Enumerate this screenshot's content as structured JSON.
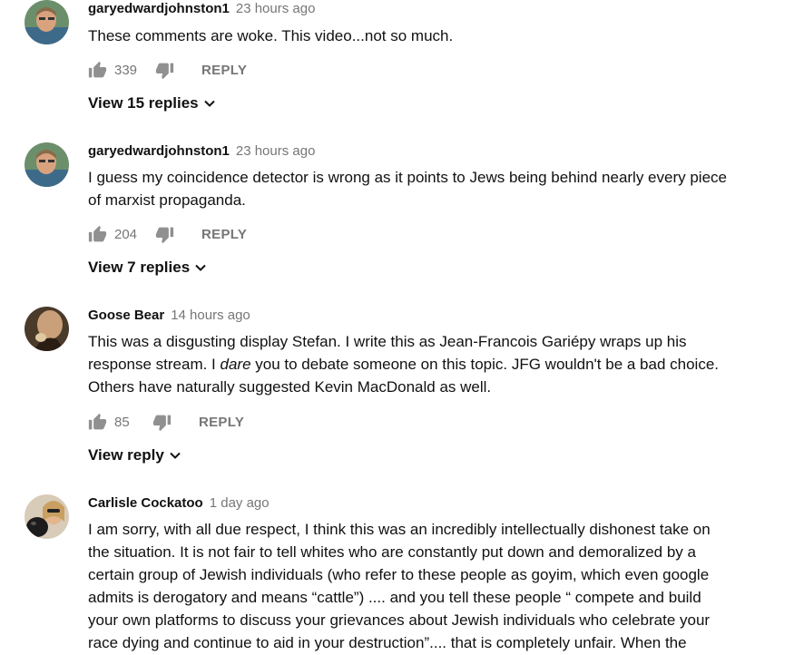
{
  "comments": [
    {
      "author": "garyedwardjohnston1",
      "time": "23 hours ago",
      "lines": [
        "These comments are woke. This video...not so much."
      ],
      "likes": "339",
      "reply_label": "REPLY",
      "view_replies": "View 15 replies",
      "avatar_icon": "man-portrait"
    },
    {
      "author": "garyedwardjohnston1",
      "time": "23 hours ago",
      "lines": [
        "I guess my coincidence detector is wrong as it points to Jews being behind nearly every piece",
        "of marxist propaganda."
      ],
      "likes": "204",
      "reply_label": "REPLY",
      "view_replies": "View 7 replies",
      "avatar_icon": "man-portrait"
    },
    {
      "author": "Goose Bear",
      "time": "14 hours ago",
      "lines": [
        "This was a disgusting display Stefan. I write this as Jean-Francois Gariépy wraps up his",
        "response stream. I ",
        "dare",
        " you to debate someone on this topic. JFG wouldn't be a bad choice.",
        "Others have naturally suggested Kevin MacDonald as well."
      ],
      "likes": "85",
      "reply_label": "REPLY",
      "view_replies": "View reply",
      "avatar_icon": "goose-bear-avatar"
    },
    {
      "author": "Carlisle Cockatoo",
      "time": "1 day ago",
      "lines": [
        "I am sorry, with all due respect, I think this was an incredibly intellectually dishonest take on",
        "the situation. It is not fair to tell whites who are constantly put down and demoralized by a",
        "certain group of Jewish individuals (who refer to these people as goyim, which even google",
        "admits is derogatory and means “cattle”) .... and you tell these people “ compete and build",
        "your own platforms to discuss your grievances about Jewish individuals who celebrate your",
        "race dying and continue to aid in your destruction”.... that is completely unfair. When the"
      ],
      "avatar_icon": "woman-with-dog-avatar"
    }
  ],
  "colors": {
    "text": "#111111",
    "meta": "#767676",
    "background": "#ffffff"
  }
}
